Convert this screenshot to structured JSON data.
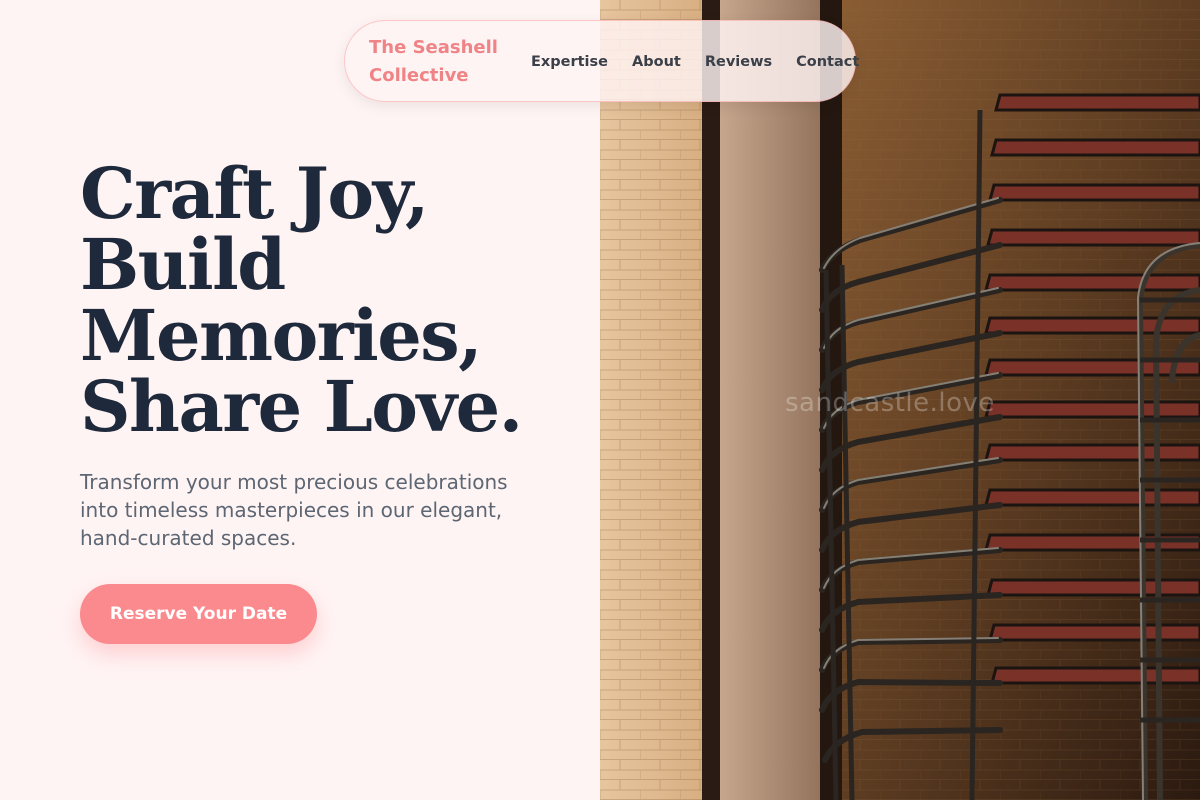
{
  "brand": {
    "name_line1": "The Seashell",
    "name_line2": "Collective"
  },
  "nav": {
    "items": [
      "Expertise",
      "About",
      "Reviews",
      "Contact"
    ]
  },
  "hero": {
    "headline": [
      "Craft Joy,",
      "Build",
      "Memories,",
      "Share Love."
    ],
    "subtext": "Transform your most precious celebrations into timeless masterpieces in our elegant, hand-curated spaces.",
    "cta_label": "Reserve Your Date"
  },
  "photo": {
    "watermark": "sandcastle.love",
    "subject": "stacked-chairs-photo"
  },
  "colors": {
    "accent": "#fb8a8e",
    "brand_text": "#f08386",
    "headline": "#1e293b",
    "background": "#fff4f4"
  }
}
